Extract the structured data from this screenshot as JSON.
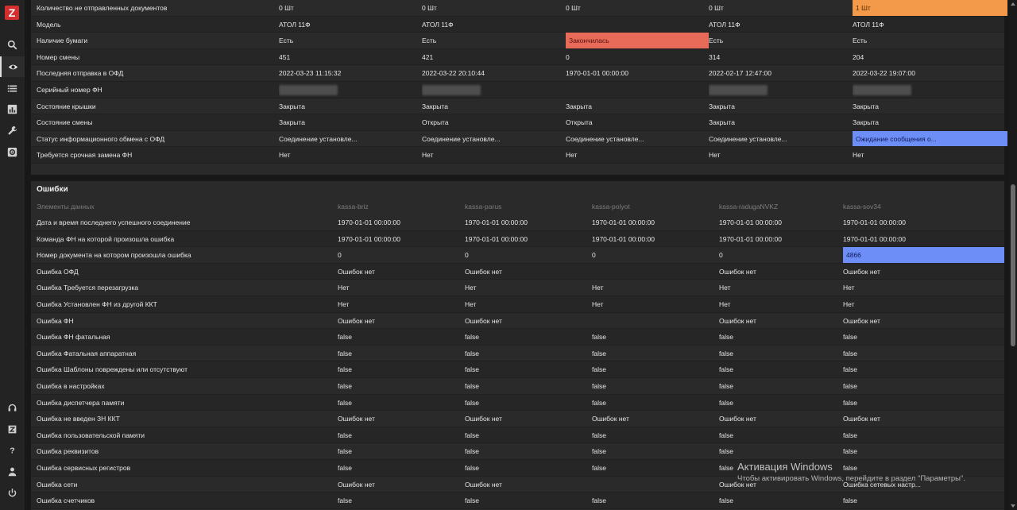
{
  "app": {
    "logo": "Z"
  },
  "nav": [
    {
      "name": "search-icon"
    },
    {
      "name": "eye-icon",
      "active": true
    },
    {
      "name": "list-icon"
    },
    {
      "name": "chart-icon"
    },
    {
      "name": "wrench-icon"
    },
    {
      "name": "gear-icon"
    },
    {
      "name": "headset-icon"
    },
    {
      "name": "zabbix-icon"
    },
    {
      "name": "help-icon"
    },
    {
      "name": "user-icon"
    },
    {
      "name": "power-icon"
    }
  ],
  "status_panel": {
    "rows": [
      {
        "label": "Количество не отправленных документов",
        "cells": [
          "0 Шт",
          "0 Шт",
          "0 Шт",
          "0 Шт",
          "1 Шт"
        ],
        "hl": [
          null,
          null,
          null,
          null,
          "orange"
        ]
      },
      {
        "label": "Модель",
        "cells": [
          "АТОЛ 11Ф",
          "АТОЛ 11Ф",
          "",
          "АТОЛ 11Ф",
          "АТОЛ 11Ф"
        ]
      },
      {
        "label": "Наличие бумаги",
        "cells": [
          "Есть",
          "Есть",
          "Закончилась",
          "Есть",
          "Есть"
        ],
        "hl": [
          null,
          null,
          "red",
          null,
          null
        ]
      },
      {
        "label": "Номер смены",
        "cells": [
          "451",
          "421",
          "0",
          "314",
          "204"
        ]
      },
      {
        "label": "Последняя отправка в ОФД",
        "cells": [
          "2022-03-23 11:15:32",
          "2022-03-22 20:10:44",
          "1970-01-01 00:00:00",
          "2022-02-17 12:47:00",
          "2022-03-22 19:07:00"
        ]
      },
      {
        "label": "Серийный номер ФН",
        "cells": [
          "",
          "",
          "",
          "",
          ""
        ],
        "blur": [
          true,
          true,
          false,
          true,
          true
        ]
      },
      {
        "label": "Состояние крышки",
        "cells": [
          "Закрыта",
          "Закрыта",
          "Закрыта",
          "Закрыта",
          "Закрыта"
        ]
      },
      {
        "label": "Состояние смены",
        "cells": [
          "Закрыта",
          "Открыта",
          "Открыта",
          "Закрыта",
          "Закрыта"
        ]
      },
      {
        "label": "Статус информационного обмена с ОФД",
        "cells": [
          "Соединение установле...",
          "Соединение установле...",
          "Соединение установле...",
          "Соединение установле...",
          "Ожидание сообщения о..."
        ],
        "hl": [
          null,
          null,
          null,
          null,
          "blue"
        ]
      },
      {
        "label": "Требуется срочная замена ФН",
        "cells": [
          "Нет",
          "Нет",
          "Нет",
          "Нет",
          "Нет"
        ]
      }
    ]
  },
  "errors_panel": {
    "title": "Ошибки",
    "header": {
      "label": "Элементы данных",
      "cols": [
        "kassa-briz",
        "kassa-parus",
        "kassa-polyot",
        "kassa-radugaNVKZ",
        "kassa-sov34"
      ]
    },
    "rows": [
      {
        "label": "Дата и время последнего успешного соединение",
        "cells": [
          "1970-01-01 00:00:00",
          "1970-01-01 00:00:00",
          "1970-01-01 00:00:00",
          "1970-01-01 00:00:00",
          "1970-01-01 00:00:00"
        ]
      },
      {
        "label": "Команда ФН на которой произошла ошибка",
        "cells": [
          "1970-01-01 00:00:00",
          "1970-01-01 00:00:00",
          "1970-01-01 00:00:00",
          "1970-01-01 00:00:00",
          "1970-01-01 00:00:00"
        ]
      },
      {
        "label": "Номер документа на котором произошла ошибка",
        "cells": [
          "0",
          "0",
          "0",
          "0",
          "4866"
        ],
        "hl": [
          null,
          null,
          null,
          null,
          "blue"
        ]
      },
      {
        "label": "Ошибка ОФД",
        "cells": [
          "Ошибок нет",
          "Ошибок нет",
          "",
          "Ошибок нет",
          "Ошибок нет"
        ]
      },
      {
        "label": "Ошибка Требуется перезагрузка",
        "cells": [
          "Нет",
          "Нет",
          "Нет",
          "Нет",
          "Нет"
        ]
      },
      {
        "label": "Ошибка Установлен ФН из другой ККТ",
        "cells": [
          "Нет",
          "Нет",
          "Нет",
          "Нет",
          "Нет"
        ]
      },
      {
        "label": "Ошибка ФН",
        "cells": [
          "Ошибок нет",
          "Ошибок нет",
          "",
          "Ошибок нет",
          "Ошибок нет"
        ]
      },
      {
        "label": "Ошибка ФН фатальная",
        "cells": [
          "false",
          "false",
          "false",
          "false",
          "false"
        ]
      },
      {
        "label": "Ошибка Фатальная аппаратная",
        "cells": [
          "false",
          "false",
          "false",
          "false",
          "false"
        ]
      },
      {
        "label": "Ошибка Шаблоны повреждены или отсутствуют",
        "cells": [
          "false",
          "false",
          "false",
          "false",
          "false"
        ]
      },
      {
        "label": "Ошибка в настройках",
        "cells": [
          "false",
          "false",
          "false",
          "false",
          "false"
        ]
      },
      {
        "label": "Ошибка диспетчера памяти",
        "cells": [
          "false",
          "false",
          "false",
          "false",
          "false"
        ]
      },
      {
        "label": "Ошибка не введен ЗН ККТ",
        "cells": [
          "Ошибок нет",
          "Ошибок нет",
          "Ошибок нет",
          "Ошибок нет",
          "Ошибок нет"
        ]
      },
      {
        "label": "Ошибка пользовательской памяти",
        "cells": [
          "false",
          "false",
          "false",
          "false",
          "false"
        ]
      },
      {
        "label": "Ошибка реквизитов",
        "cells": [
          "false",
          "false",
          "false",
          "false",
          "false"
        ]
      },
      {
        "label": "Ошибка сервисных регистров",
        "cells": [
          "false",
          "false",
          "false",
          "false",
          "false"
        ]
      },
      {
        "label": "Ошибка сети",
        "cells": [
          "Ошибок нет",
          "Ошибок нет",
          "",
          "Ошибок нет",
          "Ошибка сетевых настр..."
        ]
      },
      {
        "label": "Ошибка счетчиков",
        "cells": [
          "false",
          "false",
          "false",
          "false",
          "false"
        ]
      }
    ]
  },
  "watermark": {
    "line1": "Активация Windows",
    "line2": "Чтобы активировать Windows, перейдите в раздел \"Параметры\"."
  }
}
